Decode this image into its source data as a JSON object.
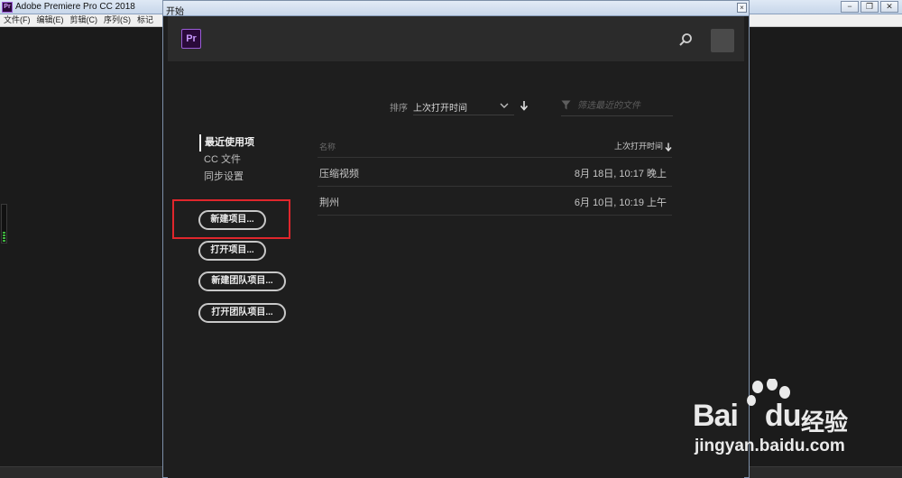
{
  "app": {
    "title": "Adobe Premiere Pro CC 2018",
    "icon_text": "Pr",
    "window_buttons": [
      "−",
      "❐",
      "✕"
    ],
    "menu": [
      "文件(F)",
      "编辑(E)",
      "剪辑(C)",
      "序列(S)",
      "标记"
    ]
  },
  "dialog": {
    "title": "开始",
    "close_label": "×",
    "logo_text": "Pr",
    "sort": {
      "label": "排序",
      "value": "上次打开时间"
    },
    "filter": {
      "placeholder": "筛选最近的文件"
    },
    "nav": [
      {
        "label": "最近使用项",
        "active": true
      },
      {
        "label": "CC 文件",
        "active": false
      },
      {
        "label": "同步设置",
        "active": false
      }
    ],
    "buttons": {
      "new_project": "新建项目...",
      "open_project": "打开项目...",
      "new_team_project": "新建团队项目...",
      "open_team_project": "打开团队项目..."
    },
    "list": {
      "col_name": "名称",
      "col_date": "上次打开时间",
      "rows": [
        {
          "name": "压缩视频",
          "date": "8月 18日, 10:17 晚上"
        },
        {
          "name": "荆州",
          "date": "6月 10日, 10:19 上午"
        }
      ]
    }
  },
  "watermark": {
    "brand": "Bai",
    "brand_suffix": "du",
    "product": "经验",
    "url": "jingyan.baidu.com"
  },
  "colors": {
    "highlight": "#e0262c",
    "accent_purple": "#9a5cd6"
  }
}
